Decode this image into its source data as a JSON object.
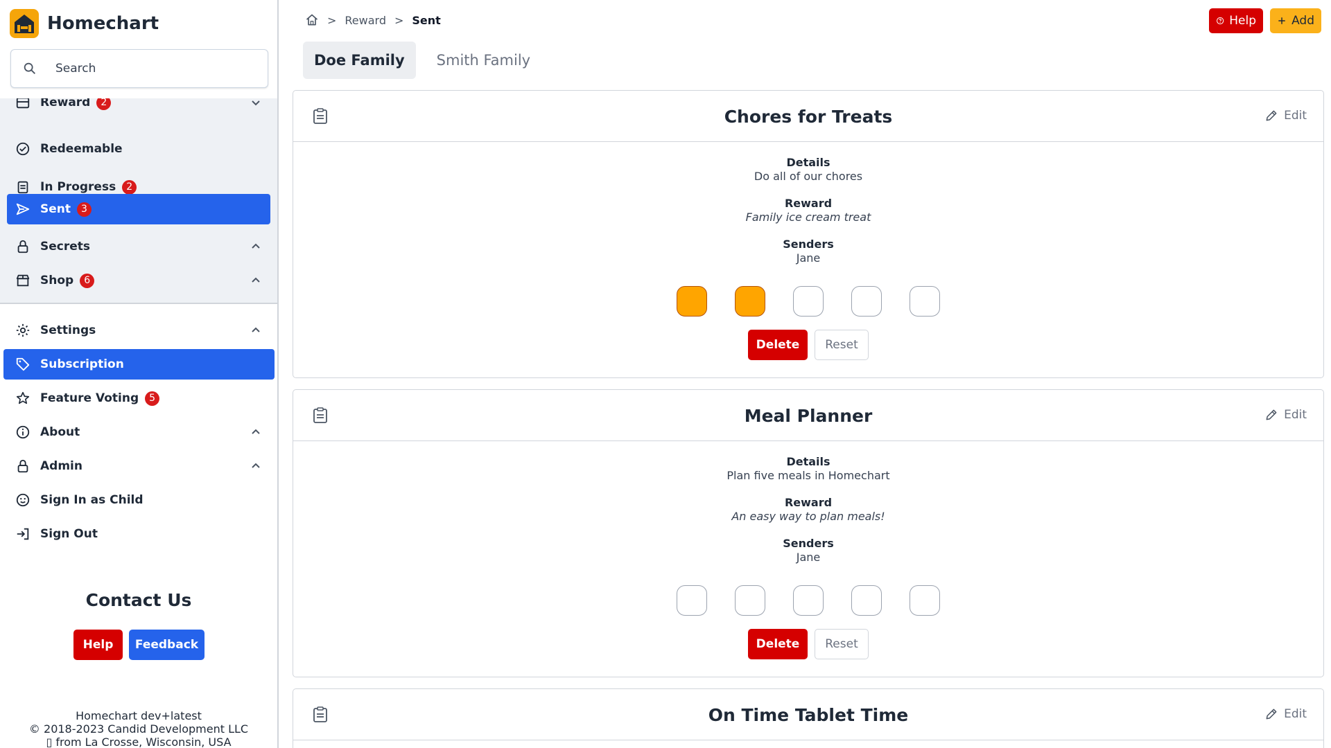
{
  "app": {
    "name": "Homechart"
  },
  "search": {
    "placeholder": "Search"
  },
  "nav_upper": [
    {
      "label": "Reward",
      "badge": "2",
      "icon": "reward-icon",
      "chevron": true
    },
    {
      "label": "Redeemable",
      "badge": "",
      "icon": "check-circle-icon"
    },
    {
      "label": "In Progress",
      "badge": "2",
      "icon": "clipboard-icon"
    },
    {
      "label": "Sent",
      "badge": "3",
      "icon": "send-icon",
      "active": true
    },
    {
      "label": "Secrets",
      "badge": "",
      "icon": "lock-icon",
      "chevron": true
    },
    {
      "label": "Shop",
      "badge": "6",
      "icon": "store-icon",
      "chevron": true
    }
  ],
  "nav_lower": [
    {
      "label": "Settings",
      "icon": "gear-icon",
      "chevron": true
    },
    {
      "label": "Subscription",
      "icon": "tag-icon",
      "active": true
    },
    {
      "label": "Feature Voting",
      "badge": "5",
      "icon": "star-icon"
    },
    {
      "label": "About",
      "icon": "info-icon",
      "chevron": true
    },
    {
      "label": "Admin",
      "icon": "lock-icon",
      "chevron": true
    },
    {
      "label": "Sign In as Child",
      "icon": "child-icon"
    },
    {
      "label": "Sign Out",
      "icon": "sign-out-icon"
    }
  ],
  "contact": {
    "title": "Contact Us",
    "help": "Help",
    "feedback": "Feedback"
  },
  "footer": {
    "version": "Homechart dev+latest",
    "copyright": "© 2018-2023 Candid Development LLC",
    "location": "▯ from La Crosse, Wisconsin, USA"
  },
  "breadcrumb": {
    "items": [
      "Reward",
      "Sent"
    ]
  },
  "top_actions": {
    "help": "Help",
    "add": "Add"
  },
  "tabs": [
    {
      "label": "Doe Family",
      "active": true
    },
    {
      "label": "Smith Family"
    }
  ],
  "labels": {
    "details": "Details",
    "reward": "Reward",
    "senders": "Senders",
    "edit": "Edit",
    "delete": "Delete",
    "reset": "Reset"
  },
  "cards": [
    {
      "title": "Chores for Treats",
      "details": "Do all of our chores",
      "reward": "Family ice cream treat",
      "senders": "Jane",
      "stamps_filled": 2,
      "stamps_total": 5
    },
    {
      "title": "Meal Planner",
      "details": "Plan five meals in Homechart",
      "reward": "An easy way to plan meals!",
      "senders": "Jane",
      "stamps_filled": 0,
      "stamps_total": 5
    },
    {
      "title": "On Time Tablet Time"
    }
  ],
  "colors": {
    "accent": "#2563eb",
    "brand": "#f5a50a",
    "danger": "#d50000",
    "stamp": "#ffa500",
    "badge": "#d81b1b"
  }
}
